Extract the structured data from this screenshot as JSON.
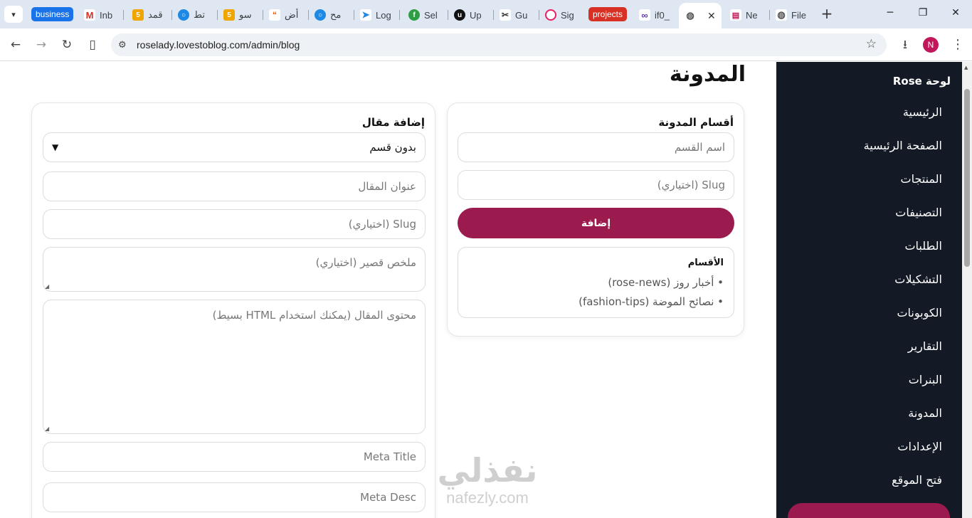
{
  "browser": {
    "groups": [
      {
        "label": "business",
        "color": "#1a73e8"
      },
      {
        "label": "projects",
        "color": "#d93025"
      }
    ],
    "tabs": [
      "Inb",
      "قمد",
      "تط",
      "سو",
      "أض",
      "مح",
      "Log",
      "Sel",
      "Up",
      "Gu",
      "Sig",
      "if0_",
      "Ne",
      "File"
    ],
    "active_tab_close": "✕",
    "url": "roselady.lovestoblog.com/admin/blog",
    "profile_initial": "N"
  },
  "page": {
    "title": "المدونة"
  },
  "categories_card": {
    "title": "أقسام المدونة",
    "name_placeholder": "اسم القسم",
    "slug_placeholder": "Slug (اختياري)",
    "add_button": "إضافة",
    "list_title": "الأقسام",
    "items": [
      "• أخبار روز (rose-news)",
      "• نصائح الموضة (fashion-tips)"
    ]
  },
  "post_card": {
    "title": "إضافة مقال",
    "category_select_value": "بدون قسم",
    "title_placeholder": "عنوان المقال",
    "slug_placeholder": "Slug (اختياري)",
    "excerpt_placeholder": "ملخص قصير (اختياري)",
    "content_placeholder": "محتوى المقال (يمكنك استخدام HTML بسيط)",
    "meta_title_placeholder": "Meta Title",
    "meta_desc_placeholder": "Meta Desc"
  },
  "sidebar": {
    "brand": "لوحة Rose",
    "items": [
      "الرئيسية",
      "الصفحة الرئيسية",
      "المنتجات",
      "التصنيفات",
      "الطلبات",
      "التشكيلات",
      "الكوبونات",
      "التقارير",
      "البنرات",
      "المدونة",
      "الإعدادات",
      "فتح الموقع"
    ]
  },
  "watermark": {
    "arabic": "نفذلي",
    "latin": "nafezly.com"
  },
  "colors": {
    "sidebar_bg": "#131a26",
    "accent": "#9c1b4f",
    "chrome_bg": "#dfe7f3"
  }
}
